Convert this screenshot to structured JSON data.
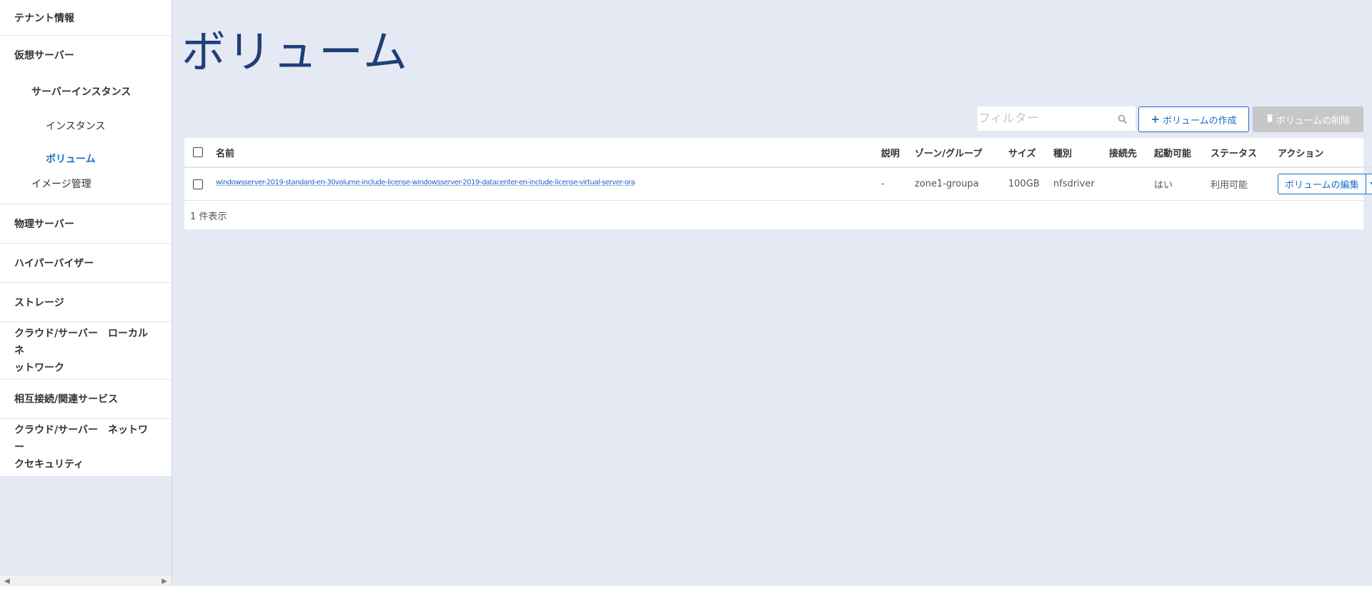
{
  "sidebar": {
    "tenant_info": "テナント情報",
    "virtual_server": "仮想サーバー",
    "server_instance": "サーバーインスタンス",
    "instance": "インスタンス",
    "volume": "ボリューム",
    "image_mgmt": "イメージ管理",
    "physical_server": "物理サーバー",
    "hypervisor": "ハイパーバイザー",
    "storage": "ストレージ",
    "cloud_local_net_line1": "クラウド/サーバー　ローカルネ",
    "cloud_local_net_line2": "ットワーク",
    "interconnect": "相互接続/関連サービス",
    "cloud_net_sec_line1": "クラウド/サーバー　ネットワー",
    "cloud_net_sec_line2": "クセキュリティ"
  },
  "main": {
    "title": "ボリューム",
    "filter_placeholder": "フィルター",
    "create_label": "ボリュームの作成",
    "delete_label": "ボリュームの削除",
    "count_text": "1 件表示"
  },
  "table": {
    "headers": {
      "name": "名前",
      "desc": "説明",
      "zone": "ゾーン/グループ",
      "size": "サイズ",
      "type": "種別",
      "attach": "接続先",
      "bootable": "起動可能",
      "status": "ステータス",
      "action": "アクション"
    },
    "rows": [
      {
        "name": "windowsserver-2019-standard-en-30volume-include-license-windowsserver-2019-datacenter-en-include-license-virtual-server-ora",
        "desc": "-",
        "zone": "zone1-groupa",
        "size": "100GB",
        "type": "nfsdriver",
        "attach": "",
        "bootable": "はい",
        "status": "利用可能",
        "edit_label": "ボリュームの編集"
      }
    ]
  },
  "colors": {
    "accent": "#1a6ec7",
    "title": "#1f3f7a",
    "background": "#e4e9f3"
  }
}
